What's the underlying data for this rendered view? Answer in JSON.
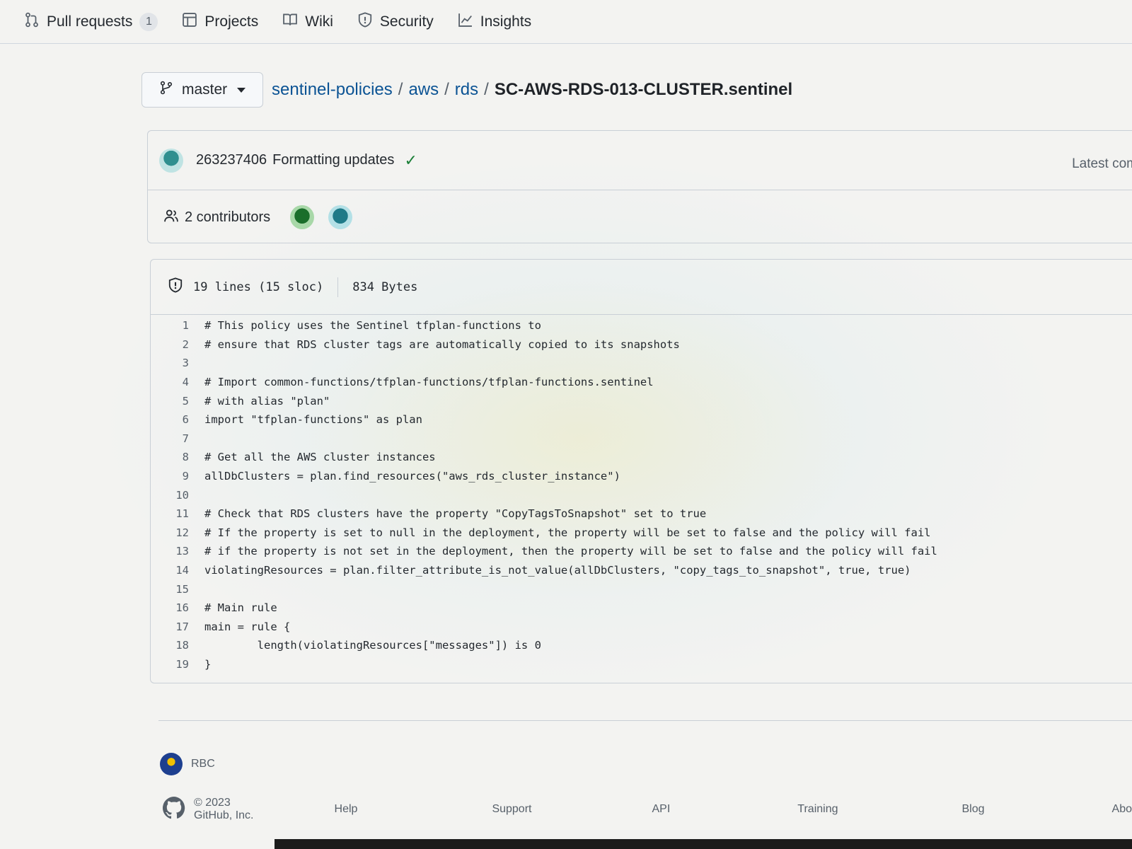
{
  "nav": {
    "items": [
      {
        "label": "Pull requests",
        "icon": "git-pull-request-icon",
        "count": "1"
      },
      {
        "label": "Projects",
        "icon": "table-icon"
      },
      {
        "label": "Wiki",
        "icon": "book-icon"
      },
      {
        "label": "Security",
        "icon": "shield-icon"
      },
      {
        "label": "Insights",
        "icon": "graph-icon"
      }
    ]
  },
  "branch": {
    "label": "master",
    "icon": "git-branch-icon"
  },
  "breadcrumb": {
    "repo": "sentinel-policies",
    "dir1": "aws",
    "dir2": "rds",
    "file": "SC-AWS-RDS-013-CLUSTER.sentinel",
    "separator": "/"
  },
  "commit": {
    "sha": "263237406",
    "message": "Formatting updates",
    "status": "✓",
    "latest": "Latest com"
  },
  "contributors": {
    "label": "2 contributors"
  },
  "file": {
    "lines_info": "19 lines (15 sloc)",
    "size": "834 Bytes",
    "code": [
      {
        "n": "1",
        "text": "# This policy uses the Sentinel tfplan-functions to"
      },
      {
        "n": "2",
        "text": "# ensure that RDS cluster tags are automatically copied to its snapshots"
      },
      {
        "n": "3",
        "text": ""
      },
      {
        "n": "4",
        "text": "# Import common-functions/tfplan-functions/tfplan-functions.sentinel"
      },
      {
        "n": "5",
        "text": "# with alias \"plan\""
      },
      {
        "n": "6",
        "text": "import \"tfplan-functions\" as plan"
      },
      {
        "n": "7",
        "text": ""
      },
      {
        "n": "8",
        "text": "# Get all the AWS cluster instances"
      },
      {
        "n": "9",
        "text": "allDbClusters = plan.find_resources(\"aws_rds_cluster_instance\")"
      },
      {
        "n": "10",
        "text": ""
      },
      {
        "n": "11",
        "text": "# Check that RDS clusters have the property \"CopyTagsToSnapshot\" set to true"
      },
      {
        "n": "12",
        "text": "# If the property is set to null in the deployment, the property will be set to false and the policy will fail"
      },
      {
        "n": "13",
        "text": "# if the property is not set in the deployment, then the property will be set to false and the policy will fail"
      },
      {
        "n": "14",
        "text": "violatingResources = plan.filter_attribute_is_not_value(allDbClusters, \"copy_tags_to_snapshot\", true, true)"
      },
      {
        "n": "15",
        "text": ""
      },
      {
        "n": "16",
        "text": "# Main rule"
      },
      {
        "n": "17",
        "text": "main = rule {"
      },
      {
        "n": "18",
        "text": "        length(violatingResources[\"messages\"]) is 0"
      },
      {
        "n": "19",
        "text": "}"
      }
    ]
  },
  "org": {
    "name": "RBC"
  },
  "footer": {
    "copyright": "© 2023 GitHub, Inc.",
    "links": [
      "Help",
      "Support",
      "API",
      "Training",
      "Blog",
      "Abo"
    ]
  }
}
